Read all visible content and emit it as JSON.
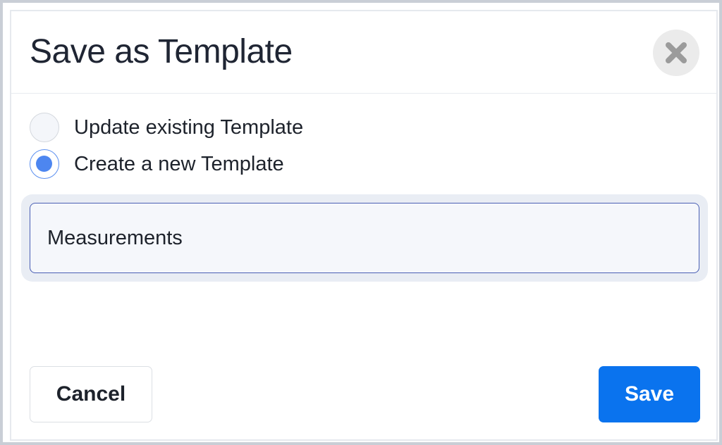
{
  "dialog": {
    "title": "Save as Template",
    "close_icon": "close-icon"
  },
  "options": [
    {
      "label": "Update existing Template",
      "checked": false
    },
    {
      "label": "Create a new Template",
      "checked": true
    }
  ],
  "template_name": {
    "value": "Measurements"
  },
  "footer": {
    "cancel_label": "Cancel",
    "save_label": "Save"
  },
  "colors": {
    "primary": "#0a73ee",
    "radio_selected": "#4d86f0",
    "input_border": "#4a5fb4"
  }
}
